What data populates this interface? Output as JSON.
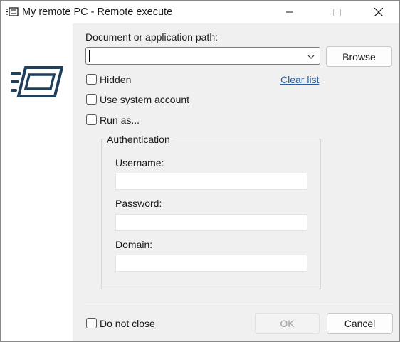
{
  "window": {
    "title": "My remote PC - Remote execute",
    "app_icon": "remote-execute-icon",
    "controls": [
      "minimize-icon",
      "maximize-icon",
      "close-icon"
    ]
  },
  "branding": {
    "logo_icon": "remote-execute-logo-icon"
  },
  "form": {
    "path_label": "Document or application path:",
    "path_value": "",
    "browse_label": "Browse",
    "hidden_label": "Hidden",
    "hidden_checked": false,
    "clear_list_label": "Clear list",
    "system_account_label": "Use system account",
    "system_account_checked": false,
    "run_as_label": "Run as...",
    "run_as_checked": false
  },
  "auth": {
    "group_title": "Authentication",
    "username_label": "Username:",
    "username_value": "",
    "password_label": "Password:",
    "password_value": "",
    "domain_label": "Domain:",
    "domain_value": ""
  },
  "footer": {
    "do_not_close_label": "Do not close",
    "do_not_close_checked": false,
    "ok_label": "OK",
    "ok_enabled": false,
    "cancel_label": "Cancel"
  },
  "colors": {
    "content_bg": "#f0f0f0",
    "link": "#2a5d9a",
    "logo": "#1f3f5c",
    "disabled_text": "#a0a0a0"
  }
}
